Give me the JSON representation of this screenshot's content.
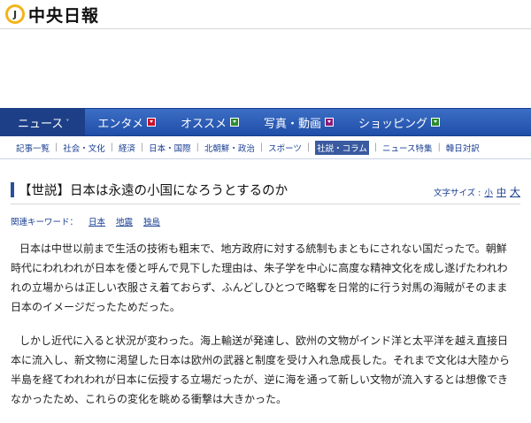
{
  "header": {
    "logo_letter": "J",
    "logo_text": "中央日報"
  },
  "gnav": {
    "items": [
      {
        "label": "ニュース",
        "indicator": "˅"
      },
      {
        "label": "エンタメ",
        "badge_color": "#c8102e"
      },
      {
        "label": "オススメ",
        "badge_color": "#2e8b2e"
      },
      {
        "label": "写真・動画",
        "badge_color": "#8b1a7a"
      },
      {
        "label": "ショッピング",
        "badge_color": "#2e8b2e"
      }
    ]
  },
  "subnav": {
    "items": [
      "記事一覧",
      "社会・文化",
      "経済",
      "日本・国際",
      "北朝鮮・政治",
      "スポーツ",
      "社説・コラム",
      "ニュース特集",
      "韓日対訳"
    ]
  },
  "article": {
    "title": "【世説】日本は永遠の小国になろうとするのか",
    "font_size_label": "文字サイズ :",
    "font_sizes": [
      "小",
      "中",
      "大"
    ],
    "keywords_label": "関連キーワード：",
    "keywords": [
      "日本",
      "地震",
      "独島"
    ],
    "paragraphs": [
      "日本は中世以前まで生活の技術も粗末で、地方政府に対する統制もまともにされない国だったで。朝鮮時代にわれわれが日本を倭と呼んで見下した理由は、朱子学を中心に高度な精神文化を成し遂げたわれわれの立場からは正しい衣服さえ着ておらず、ふんどしひとつで略奪を日常的に行う対馬の海賊がそのまま日本のイメージだったためだった。",
      "しかし近代に入ると状況が変わった。海上輸送が発達し、欧州の文物がインド洋と太平洋を越え直接日本に流入し、新文物に渇望した日本は欧州の武器と制度を受け入れ急成長した。それまで文化は大陸から半島を経てわれわれが日本に伝授する立場だったが、逆に海を通って新しい文物が流入するとは想像できなかったため、これらの変化を眺める衝撃は大きかった。"
    ]
  }
}
